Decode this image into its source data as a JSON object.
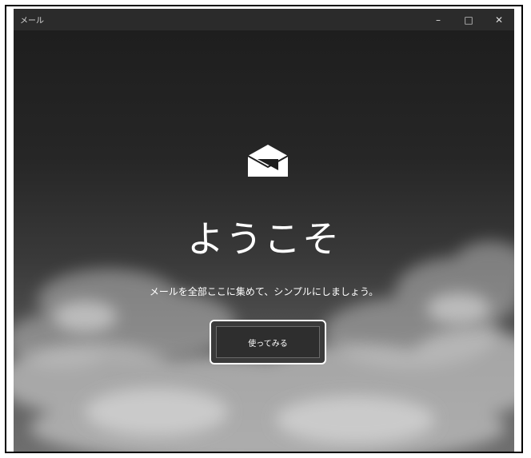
{
  "window": {
    "title": "メール",
    "minimize_icon": "minimize-icon",
    "maximize_icon": "maximize-icon",
    "close_icon": "close-icon",
    "minimize_glyph": "–",
    "maximize_glyph": "□",
    "close_glyph": "✕"
  },
  "welcome": {
    "icon": "mail-icon",
    "title": "ようこそ",
    "subtitle": "メールを全部ここに集めて、シンプルにしましょう。",
    "button_label": "使ってみる"
  },
  "colors": {
    "background_top": "#1e1e1e",
    "background_bottom": "#6e6e6e",
    "title_bar": "#2b2b2b",
    "text": "#ffffff",
    "button": "#2e2e2e"
  }
}
